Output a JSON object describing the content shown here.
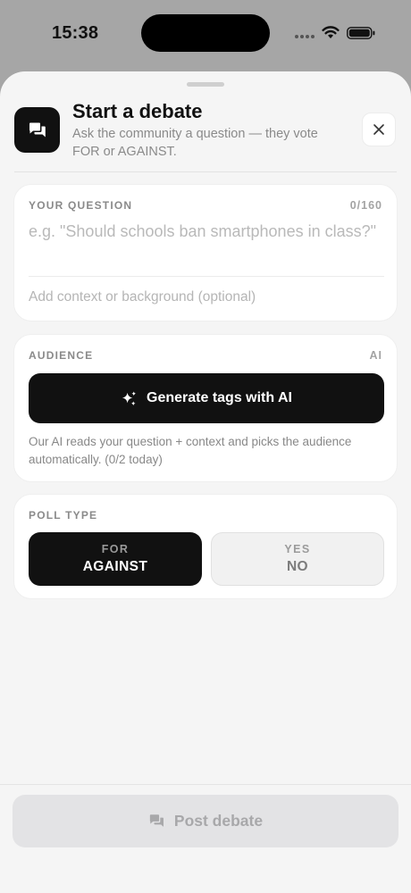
{
  "status_bar": {
    "time": "15:38"
  },
  "header": {
    "icon": "chat-bubbles-icon",
    "title": "Start a debate",
    "subtitle": "Ask the community a question — they vote FOR or AGAINST."
  },
  "question": {
    "label": "YOUR QUESTION",
    "counter": "0/160",
    "placeholder": "e.g. \"Should schools ban smartphones in class?\"",
    "context_placeholder": "Add context or background (optional)"
  },
  "audience": {
    "label": "AUDIENCE",
    "badge": "AI",
    "generate_label": "Generate tags with AI",
    "generate_icon": "sparkles-icon",
    "help_text": "Our AI reads your question + context and picks the audience automatically. (0/2 today)"
  },
  "poll_type": {
    "label": "POLL TYPE",
    "options": [
      {
        "top": "FOR",
        "bottom": "AGAINST",
        "selected": true
      },
      {
        "top": "YES",
        "bottom": "NO",
        "selected": false
      }
    ]
  },
  "footer": {
    "post_label": "Post debate",
    "post_icon": "chat-bubbles-icon"
  },
  "colors": {
    "accent": "#111111",
    "background": "#f5f5f5",
    "card": "#ffffff",
    "disabled": "#e3e3e5"
  }
}
